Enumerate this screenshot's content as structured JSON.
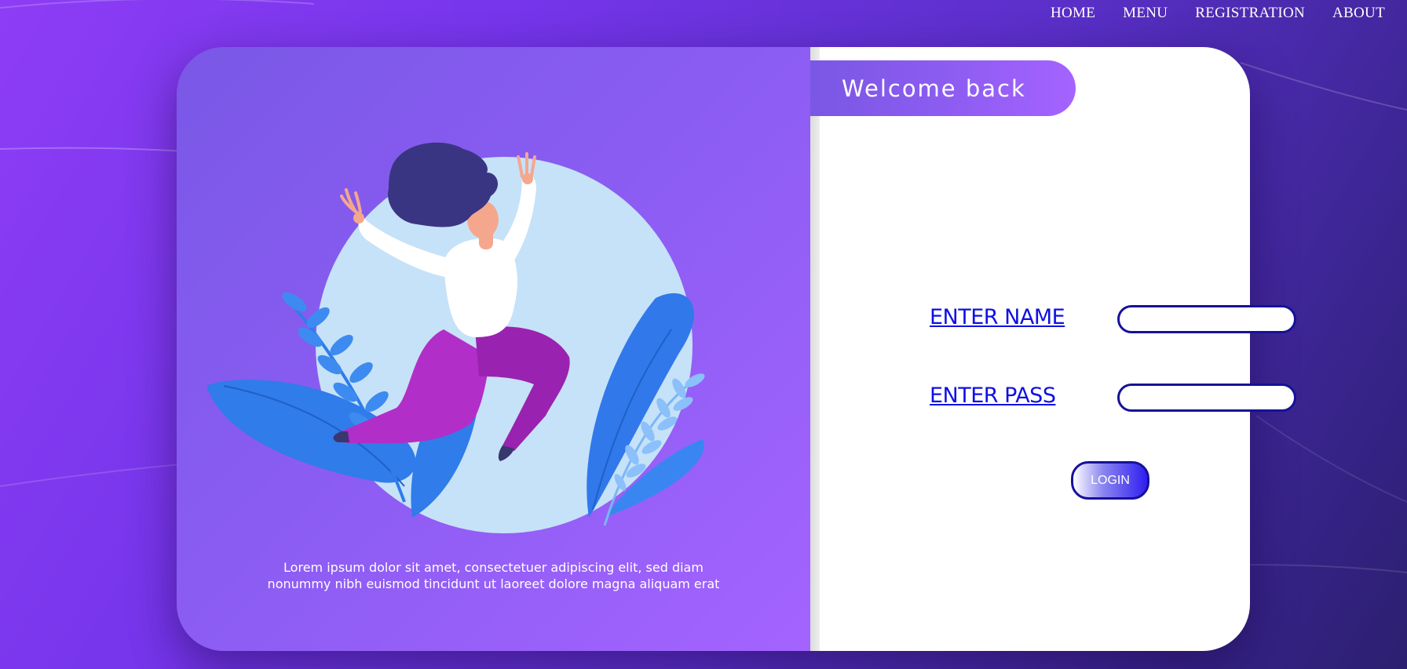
{
  "nav": {
    "items": [
      {
        "label": "HOME"
      },
      {
        "label": "MENU"
      },
      {
        "label": "REGISTRATION"
      },
      {
        "label": "ABOUT"
      }
    ]
  },
  "card": {
    "welcome": "Welcome back",
    "lorem_line1": "Lorem ipsum dolor sit amet, consectetuer adipiscing elit, sed diam",
    "lorem_line2": "nonummy nibh euismod tincidunt ut laoreet dolore magna aliquam erat",
    "illustration": "woman-jumping-illustration"
  },
  "form": {
    "name_label": "ENTER NAME",
    "name_value": "",
    "pass_label": "ENTER PASS",
    "pass_value": "",
    "login_label": "LOGIN"
  },
  "colors": {
    "accent": "#1010e6",
    "input_border": "#16119a",
    "panel_gradient_start": "#7a58e6",
    "panel_gradient_end": "#a463ff"
  }
}
